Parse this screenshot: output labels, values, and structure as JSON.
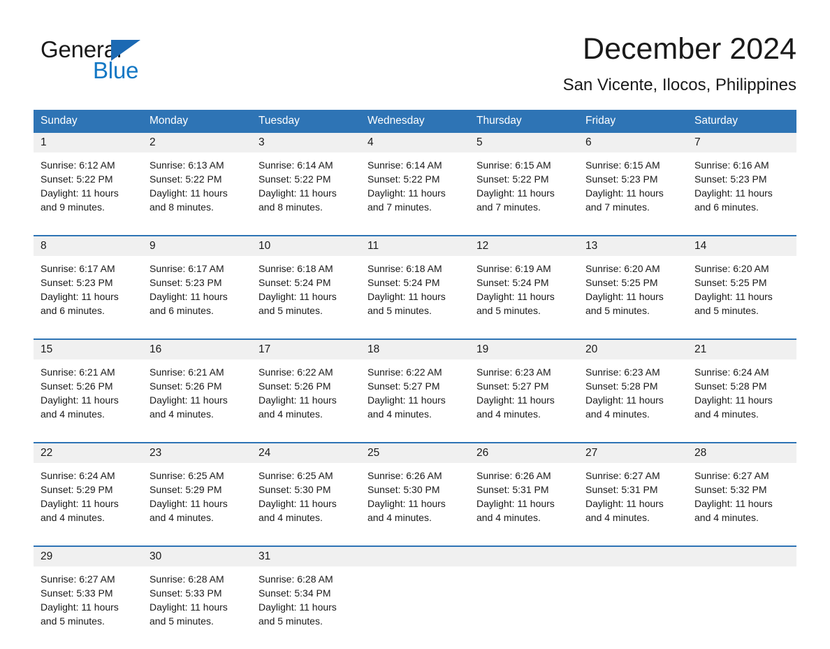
{
  "brand": {
    "name_part1": "General",
    "name_part2": "Blue",
    "logo_icon": "triangle-logo-icon"
  },
  "header": {
    "title": "December 2024",
    "location": "San Vicente, Ilocos, Philippines"
  },
  "colors": {
    "header_blue": "#2e74b5",
    "daynum_band": "#f0f0f0",
    "brand_blue": "#1277c4",
    "text": "#1a1a1a",
    "page_background": "#ffffff"
  },
  "calendar": {
    "weekday_headers": [
      "Sunday",
      "Monday",
      "Tuesday",
      "Wednesday",
      "Thursday",
      "Friday",
      "Saturday"
    ],
    "weeks": [
      {
        "days": [
          {
            "date": "1",
            "sunrise": "Sunrise: 6:12 AM",
            "sunset": "Sunset: 5:22 PM",
            "daylight": "Daylight: 11 hours and 9 minutes."
          },
          {
            "date": "2",
            "sunrise": "Sunrise: 6:13 AM",
            "sunset": "Sunset: 5:22 PM",
            "daylight": "Daylight: 11 hours and 8 minutes."
          },
          {
            "date": "3",
            "sunrise": "Sunrise: 6:14 AM",
            "sunset": "Sunset: 5:22 PM",
            "daylight": "Daylight: 11 hours and 8 minutes."
          },
          {
            "date": "4",
            "sunrise": "Sunrise: 6:14 AM",
            "sunset": "Sunset: 5:22 PM",
            "daylight": "Daylight: 11 hours and 7 minutes."
          },
          {
            "date": "5",
            "sunrise": "Sunrise: 6:15 AM",
            "sunset": "Sunset: 5:22 PM",
            "daylight": "Daylight: 11 hours and 7 minutes."
          },
          {
            "date": "6",
            "sunrise": "Sunrise: 6:15 AM",
            "sunset": "Sunset: 5:23 PM",
            "daylight": "Daylight: 11 hours and 7 minutes."
          },
          {
            "date": "7",
            "sunrise": "Sunrise: 6:16 AM",
            "sunset": "Sunset: 5:23 PM",
            "daylight": "Daylight: 11 hours and 6 minutes."
          }
        ]
      },
      {
        "days": [
          {
            "date": "8",
            "sunrise": "Sunrise: 6:17 AM",
            "sunset": "Sunset: 5:23 PM",
            "daylight": "Daylight: 11 hours and 6 minutes."
          },
          {
            "date": "9",
            "sunrise": "Sunrise: 6:17 AM",
            "sunset": "Sunset: 5:23 PM",
            "daylight": "Daylight: 11 hours and 6 minutes."
          },
          {
            "date": "10",
            "sunrise": "Sunrise: 6:18 AM",
            "sunset": "Sunset: 5:24 PM",
            "daylight": "Daylight: 11 hours and 5 minutes."
          },
          {
            "date": "11",
            "sunrise": "Sunrise: 6:18 AM",
            "sunset": "Sunset: 5:24 PM",
            "daylight": "Daylight: 11 hours and 5 minutes."
          },
          {
            "date": "12",
            "sunrise": "Sunrise: 6:19 AM",
            "sunset": "Sunset: 5:24 PM",
            "daylight": "Daylight: 11 hours and 5 minutes."
          },
          {
            "date": "13",
            "sunrise": "Sunrise: 6:20 AM",
            "sunset": "Sunset: 5:25 PM",
            "daylight": "Daylight: 11 hours and 5 minutes."
          },
          {
            "date": "14",
            "sunrise": "Sunrise: 6:20 AM",
            "sunset": "Sunset: 5:25 PM",
            "daylight": "Daylight: 11 hours and 5 minutes."
          }
        ]
      },
      {
        "days": [
          {
            "date": "15",
            "sunrise": "Sunrise: 6:21 AM",
            "sunset": "Sunset: 5:26 PM",
            "daylight": "Daylight: 11 hours and 4 minutes."
          },
          {
            "date": "16",
            "sunrise": "Sunrise: 6:21 AM",
            "sunset": "Sunset: 5:26 PM",
            "daylight": "Daylight: 11 hours and 4 minutes."
          },
          {
            "date": "17",
            "sunrise": "Sunrise: 6:22 AM",
            "sunset": "Sunset: 5:26 PM",
            "daylight": "Daylight: 11 hours and 4 minutes."
          },
          {
            "date": "18",
            "sunrise": "Sunrise: 6:22 AM",
            "sunset": "Sunset: 5:27 PM",
            "daylight": "Daylight: 11 hours and 4 minutes."
          },
          {
            "date": "19",
            "sunrise": "Sunrise: 6:23 AM",
            "sunset": "Sunset: 5:27 PM",
            "daylight": "Daylight: 11 hours and 4 minutes."
          },
          {
            "date": "20",
            "sunrise": "Sunrise: 6:23 AM",
            "sunset": "Sunset: 5:28 PM",
            "daylight": "Daylight: 11 hours and 4 minutes."
          },
          {
            "date": "21",
            "sunrise": "Sunrise: 6:24 AM",
            "sunset": "Sunset: 5:28 PM",
            "daylight": "Daylight: 11 hours and 4 minutes."
          }
        ]
      },
      {
        "days": [
          {
            "date": "22",
            "sunrise": "Sunrise: 6:24 AM",
            "sunset": "Sunset: 5:29 PM",
            "daylight": "Daylight: 11 hours and 4 minutes."
          },
          {
            "date": "23",
            "sunrise": "Sunrise: 6:25 AM",
            "sunset": "Sunset: 5:29 PM",
            "daylight": "Daylight: 11 hours and 4 minutes."
          },
          {
            "date": "24",
            "sunrise": "Sunrise: 6:25 AM",
            "sunset": "Sunset: 5:30 PM",
            "daylight": "Daylight: 11 hours and 4 minutes."
          },
          {
            "date": "25",
            "sunrise": "Sunrise: 6:26 AM",
            "sunset": "Sunset: 5:30 PM",
            "daylight": "Daylight: 11 hours and 4 minutes."
          },
          {
            "date": "26",
            "sunrise": "Sunrise: 6:26 AM",
            "sunset": "Sunset: 5:31 PM",
            "daylight": "Daylight: 11 hours and 4 minutes."
          },
          {
            "date": "27",
            "sunrise": "Sunrise: 6:27 AM",
            "sunset": "Sunset: 5:31 PM",
            "daylight": "Daylight: 11 hours and 4 minutes."
          },
          {
            "date": "28",
            "sunrise": "Sunrise: 6:27 AM",
            "sunset": "Sunset: 5:32 PM",
            "daylight": "Daylight: 11 hours and 4 minutes."
          }
        ]
      },
      {
        "days": [
          {
            "date": "29",
            "sunrise": "Sunrise: 6:27 AM",
            "sunset": "Sunset: 5:33 PM",
            "daylight": "Daylight: 11 hours and 5 minutes."
          },
          {
            "date": "30",
            "sunrise": "Sunrise: 6:28 AM",
            "sunset": "Sunset: 5:33 PM",
            "daylight": "Daylight: 11 hours and 5 minutes."
          },
          {
            "date": "31",
            "sunrise": "Sunrise: 6:28 AM",
            "sunset": "Sunset: 5:34 PM",
            "daylight": "Daylight: 11 hours and 5 minutes."
          },
          {
            "date": "",
            "sunrise": "",
            "sunset": "",
            "daylight": ""
          },
          {
            "date": "",
            "sunrise": "",
            "sunset": "",
            "daylight": ""
          },
          {
            "date": "",
            "sunrise": "",
            "sunset": "",
            "daylight": ""
          },
          {
            "date": "",
            "sunrise": "",
            "sunset": "",
            "daylight": ""
          }
        ]
      }
    ]
  }
}
